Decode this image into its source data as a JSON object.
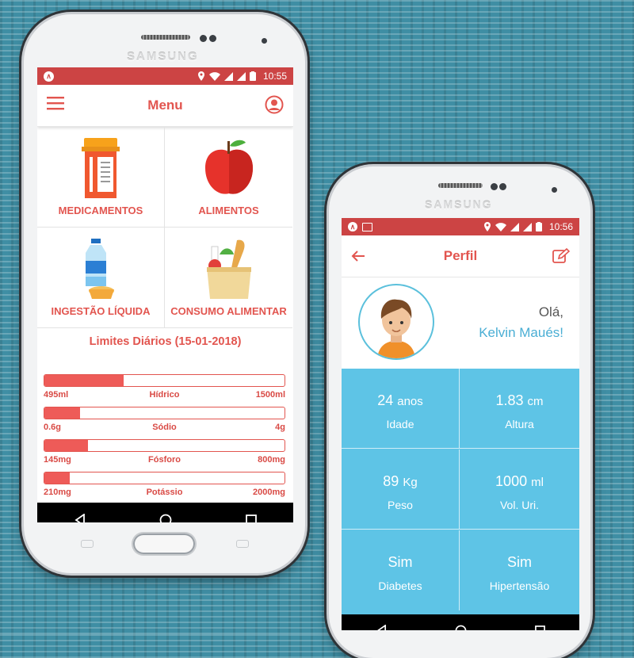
{
  "colors": {
    "brand_red": "#cc4444",
    "accent": "#e2554f",
    "sky": "#5ec4e6",
    "background": "#3f8ea4"
  },
  "phone1": {
    "brand": "SAMSUNG",
    "status": {
      "time": "10:55"
    },
    "appbar": {
      "title": "Menu",
      "left_icon": "hamburger-icon",
      "right_icon": "profile-icon"
    },
    "menu": [
      {
        "label": "MEDICAMENTOS",
        "icon": "medicine-bottle-icon"
      },
      {
        "label": "ALIMENTOS",
        "icon": "apple-icon"
      },
      {
        "label": "INGESTÃO LÍQUIDA",
        "icon": "water-bottle-icon"
      },
      {
        "label": "CONSUMO ALIMENTAR",
        "icon": "grocery-bag-icon"
      }
    ],
    "limits_title": "Limites Diários (15-01-2018)",
    "limits": [
      {
        "current": "495ml",
        "name": "Hídrico",
        "max": "1500ml",
        "fraction": 0.33
      },
      {
        "current": "0.6g",
        "name": "Sódio",
        "max": "4g",
        "fraction": 0.15
      },
      {
        "current": "145mg",
        "name": "Fósforo",
        "max": "800mg",
        "fraction": 0.18
      },
      {
        "current": "210mg",
        "name": "Potássio",
        "max": "2000mg",
        "fraction": 0.105
      }
    ]
  },
  "phone2": {
    "brand": "SAMSUNG",
    "status": {
      "time": "10:56"
    },
    "appbar": {
      "title": "Perfil",
      "left_icon": "back-arrow-icon",
      "right_icon": "edit-icon"
    },
    "greeting": "Olá,",
    "user_name": "Kelvin Maués!",
    "stats": [
      {
        "value": "24",
        "unit": "anos",
        "label": "Idade"
      },
      {
        "value": "1.83",
        "unit": "cm",
        "label": "Altura"
      },
      {
        "value": "89",
        "unit": "Kg",
        "label": "Peso"
      },
      {
        "value": "1000",
        "unit": "ml",
        "label": "Vol. Uri."
      },
      {
        "value": "Sim",
        "unit": "",
        "label": "Diabetes"
      },
      {
        "value": "Sim",
        "unit": "",
        "label": "Hipertensão"
      }
    ]
  }
}
